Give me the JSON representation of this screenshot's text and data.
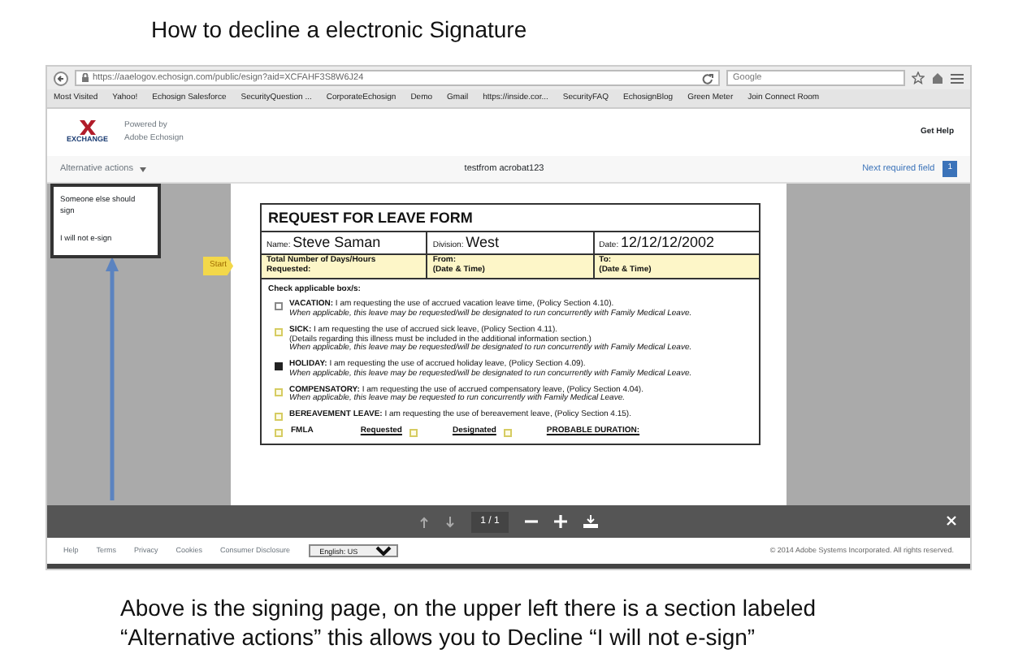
{
  "title": "How to decline a electronic Signature",
  "browser": {
    "url": "https://aaelogov.echosign.com/public/esign?aid=XCFAHF3S8W6J24",
    "search_placeholder": "Google",
    "bookmarks": [
      "Most Visited",
      "Yahoo!",
      "Echosign Salesforce",
      "SecurityQuestion ...",
      "CorporateEchosign",
      "Demo",
      "Gmail",
      "https://inside.cor...",
      "SecurityFAQ",
      "EchosignBlog",
      "Green Meter",
      "Join Connect Room"
    ]
  },
  "header": {
    "logo_text": "EXCHANGE",
    "powered_by": "Powered by",
    "brand": "Adobe Echosign",
    "help": "Get Help"
  },
  "toolbar": {
    "menu_label": "Alternative actions",
    "document_title": "testfrom acrobat123",
    "next_field": "Next required field",
    "next_count": "1"
  },
  "menu": [
    {
      "label": "Someone else should sign"
    },
    {
      "label": "I will not e-sign"
    }
  ],
  "start_tag": "Start",
  "form": {
    "title": "REQUEST FOR LEAVE FORM",
    "fields": [
      {
        "label": "Name:",
        "value": "Steve Saman"
      },
      {
        "label": "Division:",
        "value": "West"
      },
      {
        "label": "Date:",
        "value": "12/12/12/2002"
      }
    ],
    "time_fields": [
      {
        "label": "Total Number of Days/Hours Requested:"
      },
      {
        "label": "From:",
        "note": "(Date & Time)"
      },
      {
        "label": "To:",
        "note": "(Date & Time)"
      }
    ],
    "check_heading": "Check applicable box/s:",
    "options": [
      {
        "name": "VACATION:",
        "text": "I am requesting the use of accrued vacation leave time, (Policy Section 4.10).",
        "note": "When applicable, this leave may be requested/will be designated to run concurrently with Family Medical Leave.",
        "checked": false,
        "highlighted": false
      },
      {
        "name": "SICK:",
        "text": "I am requesting the use of accrued sick leave, (Policy Section 4.11).",
        "detail": "(Details regarding this illness must be included in the additional information section.)",
        "note": "When applicable, this leave may be requested/will be designated to run concurrently with Family Medical Leave.",
        "checked": false,
        "highlighted": true
      },
      {
        "name": "HOLIDAY:",
        "text": "I am requesting the use of accrued holiday leave, (Policy Section 4.09).",
        "note": "When applicable, this leave may be requested/will be designated to run concurrently with Family Medical Leave.",
        "checked": true,
        "highlighted": false
      },
      {
        "name": "COMPENSATORY:",
        "text": "I am requesting the use of accrued compensatory leave, (Policy Section 4.04).",
        "note": "When applicable, this leave may be requested to run concurrently with Family Medical Leave.",
        "checked": false,
        "highlighted": true
      },
      {
        "name": "BEREAVEMENT LEAVE:",
        "text": "I am requesting the use of bereavement leave, (Policy Section 4.15).",
        "checked": false,
        "highlighted": true
      }
    ],
    "fmla": {
      "boxes": [
        {
          "checked": false,
          "highlighted": true
        },
        {
          "checked": false,
          "highlighted": true
        },
        {
          "checked": false,
          "highlighted": true
        }
      ],
      "label": "FMLA",
      "requested": "Requested",
      "designated": "Designated",
      "duration": "PROBABLE DURATION:"
    }
  },
  "pdf_toolbar": {
    "page": "1 / 1"
  },
  "footer": {
    "links": [
      "Help",
      "Terms",
      "Privacy",
      "Cookies",
      "Consumer Disclosure"
    ],
    "language": "English: US",
    "copyright": "© 2014 Adobe Systems Incorporated. All rights reserved."
  },
  "caption_lines": [
    "Above is the signing page, on the upper left there is a section labeled",
    "“Alternative actions”  this allows you to Decline  “I will not e-sign”"
  ]
}
